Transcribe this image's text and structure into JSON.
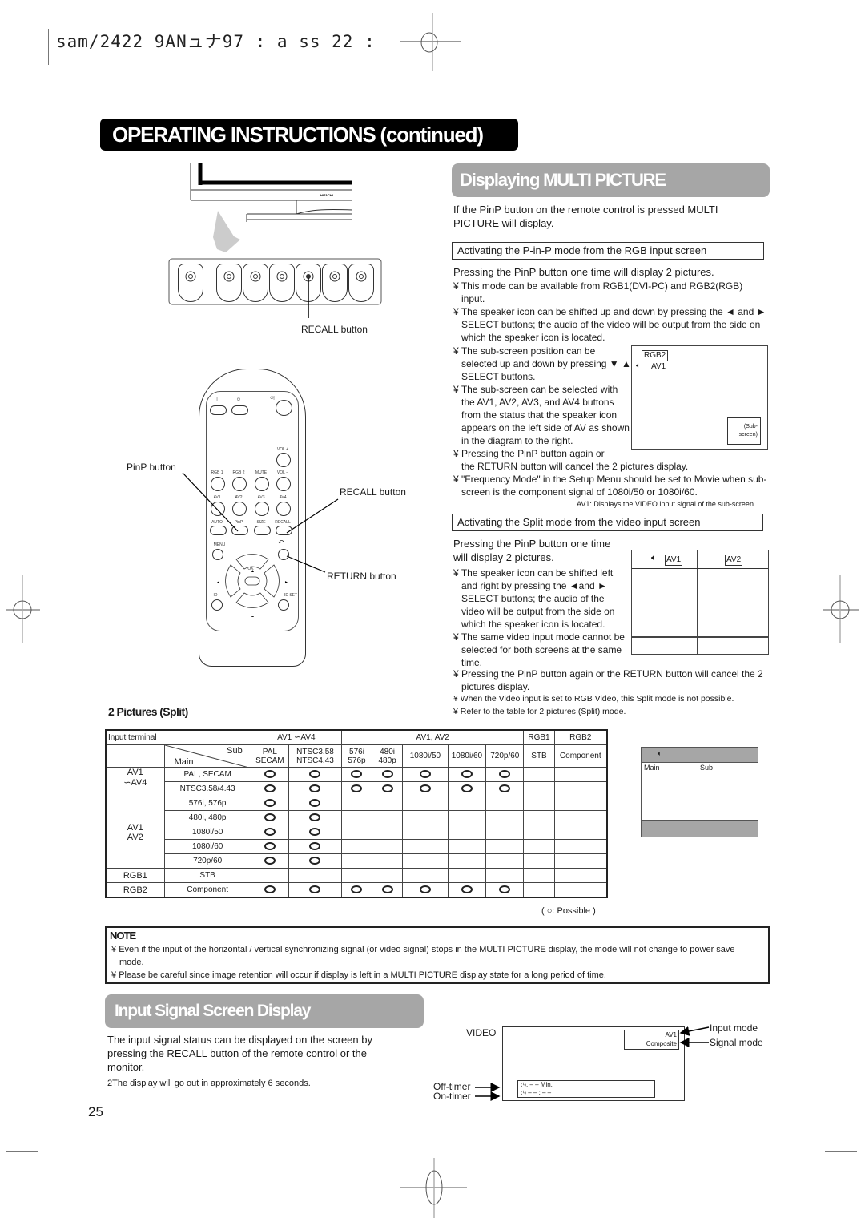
{
  "header": {
    "print_code": "sam/2422 9ANュナ97   : a   ss  22          :"
  },
  "page_title": "OPERATING INSTRUCTIONS (continued)",
  "monitor_diagram": {
    "brand": "HITACHI",
    "recall_label": "RECALL button",
    "front_buttons": 7
  },
  "remote": {
    "top_keys": [
      "|",
      "⏻",
      "⏻|"
    ],
    "row_vol_plus": "VOL +",
    "row1": [
      "RGB 1",
      "RGB 2",
      "MUTE",
      "VOL −"
    ],
    "row2": [
      "AV1",
      "AV2",
      "AV3",
      "AV4"
    ],
    "row3": [
      "AUTO",
      "PinP",
      "SIZE",
      "RECALL"
    ],
    "menu": "MENU",
    "ok": "OK",
    "id": "ID",
    "id_set": "ID SET",
    "callouts": {
      "pinp": "PinP button",
      "recall": "RECALL button",
      "return": "RETURN button"
    }
  },
  "multi_picture": {
    "heading": "Displaying MULTI PICTURE",
    "intro": "If the PinP button on the remote control is pressed MULTI PICTURE will display.",
    "pinp_section": {
      "title": "Activating the P-in-P mode from the RGB input screen",
      "lead": "Pressing the PinP button one time will display 2 pictures.",
      "bullets_full": [
        "This mode can be available from RGB1(DVI-PC) and RGB2(RGB) input.",
        "The speaker icon can be shifted up and down by pressing the ◄ and ► SELECT buttons; the audio of the video will be output from the side on which the speaker icon is located."
      ],
      "bullets_narrow": [
        "The sub-screen position can be selected up and down by pressing ▼ ▲ SELECT buttons.",
        "The sub-screen can be selected with the AV1, AV2, AV3, and AV4 buttons from the status that the speaker icon appears on the left side of AV   as shown in the diagram to the right.",
        "Pressing the PinP button again or"
      ],
      "bullets_after": [
        "the RETURN button will cancel the 2 pictures display.",
        "\"Frequency Mode\" in the Setup Menu should be set to Movie when sub-screen is the component signal of 1080i/50 or 1080i/60."
      ],
      "footnote": "AV1: Displays the VIDEO input signal of the sub-screen.",
      "diagram": {
        "main_label": "RGB2",
        "sub_label": "AV1",
        "sub_screen_label": "(Sub-screen)"
      }
    },
    "split_section": {
      "title": "Activating the Split mode from the video input screen",
      "lead": "Pressing the PinP button one time will display 2 pictures.",
      "bullets_narrow": [
        "The speaker icon can be shifted left and right by pressing the ◄and ► SELECT buttons; the audio of the video will be output from the side on which the speaker icon is located.",
        "The same video input mode cannot be selected for both screens at the same time."
      ],
      "bullets_full": [
        "Pressing the PinP button again or the RETURN button will cancel the 2 pictures display."
      ],
      "bullets_small": [
        "When the Video input is set to RGB Video, this Split mode is not possible.",
        "Refer to the table for 2 pictures (Split) mode."
      ],
      "diagram": {
        "left": "AV1",
        "right": "AV2"
      }
    },
    "bullet_glyph": "¥"
  },
  "split_table": {
    "heading": "2 Pictures (Split)",
    "input_terminal_label": "Input terminal",
    "sub_label": "Sub",
    "main_label": "Main",
    "group_headers": [
      "AV1 ∽AV4",
      "AV1, AV2",
      "RGB1",
      "RGB2"
    ],
    "columns": [
      [
        "PAL",
        "SECAM"
      ],
      [
        "NTSC3.58",
        "NTSC4.43"
      ],
      [
        "576i",
        "576p"
      ],
      [
        "480i",
        "480p"
      ],
      [
        "1080i/50"
      ],
      [
        "1080i/60"
      ],
      [
        "720p/60"
      ],
      [
        "STB"
      ],
      [
        "Component"
      ]
    ],
    "rows": [
      {
        "group": "AV1 ∽AV4",
        "signal": "PAL, SECAM",
        "marks": [
          1,
          1,
          1,
          1,
          1,
          1,
          1,
          0,
          0
        ]
      },
      {
        "group": "",
        "signal": "NTSC3.58/4.43",
        "marks": [
          1,
          1,
          1,
          1,
          1,
          1,
          1,
          0,
          0
        ]
      },
      {
        "group": "AV1 AV2",
        "signal": "576i, 576p",
        "marks": [
          1,
          1,
          0,
          0,
          0,
          0,
          0,
          0,
          0
        ]
      },
      {
        "group": "",
        "signal": "480i, 480p",
        "marks": [
          1,
          1,
          0,
          0,
          0,
          0,
          0,
          0,
          0
        ]
      },
      {
        "group": "",
        "signal": "1080i/50",
        "marks": [
          1,
          1,
          0,
          0,
          0,
          0,
          0,
          0,
          0
        ]
      },
      {
        "group": "",
        "signal": "1080i/60",
        "marks": [
          1,
          1,
          0,
          0,
          0,
          0,
          0,
          0,
          0
        ]
      },
      {
        "group": "",
        "signal": "720p/60",
        "marks": [
          1,
          1,
          0,
          0,
          0,
          0,
          0,
          0,
          0
        ]
      },
      {
        "group": "RGB1",
        "signal": "STB",
        "marks": [
          0,
          0,
          0,
          0,
          0,
          0,
          0,
          0,
          0
        ]
      },
      {
        "group": "RGB2",
        "signal": "Component",
        "marks": [
          1,
          1,
          1,
          1,
          1,
          1,
          1,
          0,
          0
        ]
      }
    ],
    "legend": "( ○: Possible )",
    "screen_diagram": {
      "main": "Main",
      "sub": "Sub"
    }
  },
  "note": {
    "title": "NOTE",
    "items": [
      "Even if the input of the horizontal / vertical synchronizing signal (or video signal) stops in the MULTI PICTURE display, the mode will not change to power save mode.",
      "Please be careful since image retention will occur if display is left in a MULTI PICTURE display state for a long period of time."
    ]
  },
  "input_signal": {
    "heading": "Input Signal Screen Display",
    "body": "The input signal status can be displayed on the screen by pressing the RECALL button of the remote control or the monitor.",
    "footnote": "2The display will go out in approximately 6 seconds.",
    "diagram": {
      "title": "VIDEO",
      "input_mode_value": "AV1",
      "signal_mode_value": "Composite",
      "input_mode_label": "Input mode",
      "signal_mode_label": "Signal mode",
      "off_timer_label": "Off-timer",
      "on_timer_label": "On-timer",
      "off_timer_value": "– – Min.",
      "on_timer_value": "– – : – –"
    }
  },
  "page_number": "25"
}
